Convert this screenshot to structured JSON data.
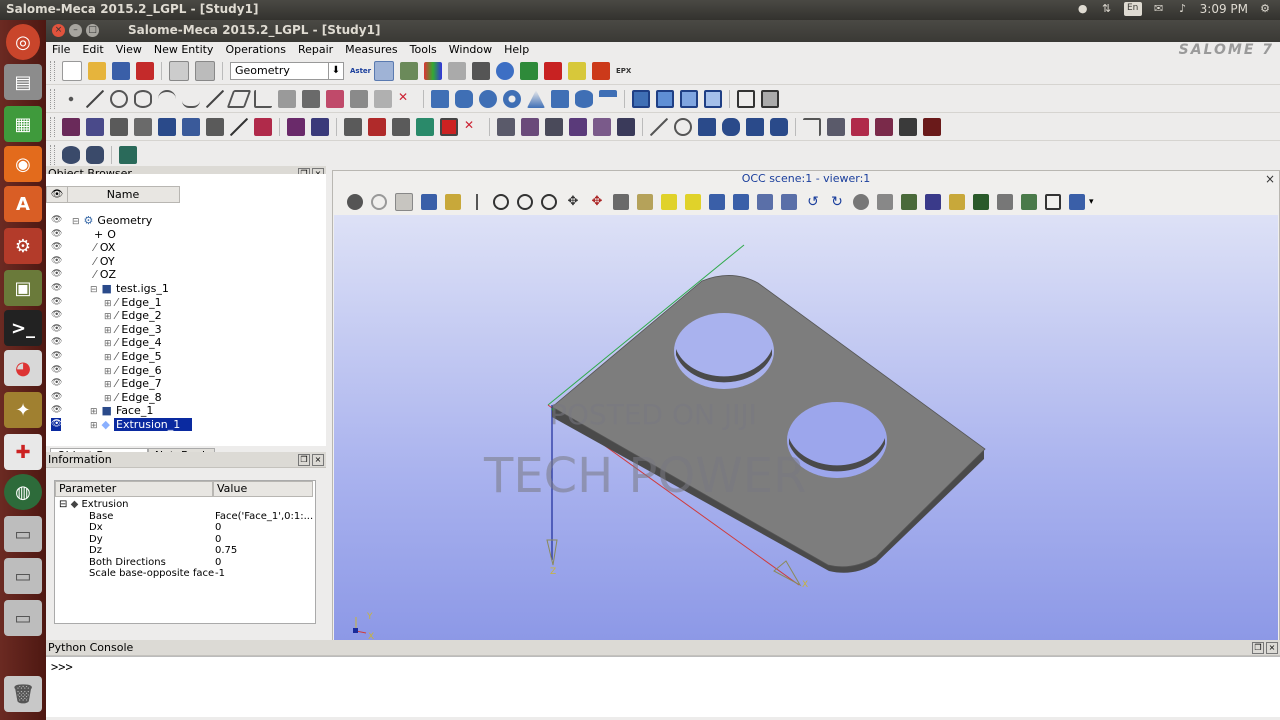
{
  "system": {
    "title": "Salome-Meca 2015.2_LGPL - [Study1]",
    "lang_indicator": "En",
    "clock": "3:09 PM"
  },
  "window": {
    "title": "Salome-Meca 2015.2_LGPL - [Study1]",
    "logo": "SALOME 7"
  },
  "menu": [
    "File",
    "Edit",
    "View",
    "New Entity",
    "Operations",
    "Repair",
    "Measures",
    "Tools",
    "Window",
    "Help"
  ],
  "toolbar": {
    "module_combo": "Geometry",
    "aster_label": "Aster",
    "epx_label": "EPX"
  },
  "object_browser": {
    "title": "Object Browser",
    "column_name": "Name",
    "items": [
      {
        "label": "Geometry",
        "level": 1
      },
      {
        "label": "O",
        "level": 2
      },
      {
        "label": "OX",
        "level": 2
      },
      {
        "label": "OY",
        "level": 2
      },
      {
        "label": "OZ",
        "level": 2
      },
      {
        "label": "test.igs_1",
        "level": 2
      },
      {
        "label": "Edge_1",
        "level": 3
      },
      {
        "label": "Edge_2",
        "level": 3
      },
      {
        "label": "Edge_3",
        "level": 3
      },
      {
        "label": "Edge_4",
        "level": 3
      },
      {
        "label": "Edge_5",
        "level": 3
      },
      {
        "label": "Edge_6",
        "level": 3
      },
      {
        "label": "Edge_7",
        "level": 3
      },
      {
        "label": "Edge_8",
        "level": 3
      },
      {
        "label": "Face_1",
        "level": 2
      },
      {
        "label": "Extrusion_1",
        "level": 2,
        "selected": true
      }
    ],
    "tabs": [
      "Object Browser",
      "NoteBook"
    ]
  },
  "information": {
    "title": "Information",
    "col_parameter": "Parameter",
    "col_value": "Value",
    "root": "Extrusion",
    "rows": [
      {
        "param": "Base",
        "value": "Face('Face_1',0:1:..."
      },
      {
        "param": "Dx",
        "value": "0"
      },
      {
        "param": "Dy",
        "value": "0"
      },
      {
        "param": "Dz",
        "value": "0.75"
      },
      {
        "param": "Both Directions",
        "value": "0"
      },
      {
        "param": "Scale base-opposite face",
        "value": "-1"
      }
    ]
  },
  "viewer": {
    "title": "OCC scene:1 - viewer:1",
    "axis_x": "X",
    "axis_y": "Y",
    "axis_z": "Z"
  },
  "watermark": {
    "line1": "POSTED ON JIJI",
    "line2": "TECH POWER"
  },
  "python_console": {
    "title": "Python Console",
    "prompt": ">>>"
  },
  "colors": {
    "launcher": "#5c1f1a",
    "viewer_top": "#dde1f6",
    "viewer_bottom": "#8b97e6",
    "part_face": "#7d7d7d",
    "selection": "#0a2aa0"
  }
}
